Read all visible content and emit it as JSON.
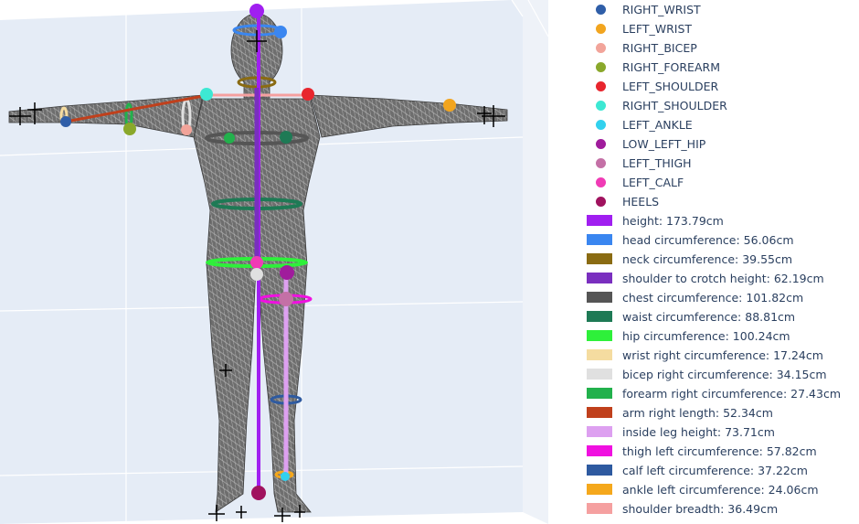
{
  "legend": {
    "markers": [
      {
        "label": "RIGHT_WRIST",
        "color": "#2f5ea8"
      },
      {
        "label": "LEFT_WRIST",
        "color": "#f2a51f"
      },
      {
        "label": "RIGHT_BICEP",
        "color": "#f2a49a"
      },
      {
        "label": "RIGHT_FOREARM",
        "color": "#8aa82b"
      },
      {
        "label": "LEFT_SHOULDER",
        "color": "#e8262e"
      },
      {
        "label": "RIGHT_SHOULDER",
        "color": "#3de8d3"
      },
      {
        "label": "LEFT_ANKLE",
        "color": "#32d1ee"
      },
      {
        "label": "LOW_LEFT_HIP",
        "color": "#a01c9c"
      },
      {
        "label": "LEFT_THIGH",
        "color": "#c470a6"
      },
      {
        "label": "LEFT_CALF",
        "color": "#f03bb5"
      },
      {
        "label": "HEELS",
        "color": "#a0125e"
      }
    ],
    "measurements": [
      {
        "label": "height: 173.79cm",
        "color": "#a01ff0"
      },
      {
        "label": "head circumference: 56.06cm",
        "color": "#3a86f0"
      },
      {
        "label": "neck circumference: 39.55cm",
        "color": "#8a6b12"
      },
      {
        "label": "shoulder to crotch height: 62.19cm",
        "color": "#7a2fbf"
      },
      {
        "label": "chest circumference: 101.82cm",
        "color": "#555555"
      },
      {
        "label": "waist circumference: 88.81cm",
        "color": "#1e7a55"
      },
      {
        "label": "hip circumference: 100.24cm",
        "color": "#2ef03a"
      },
      {
        "label": "wrist right circumference: 17.24cm",
        "color": "#f5dca0"
      },
      {
        "label": "bicep right circumference: 34.15cm",
        "color": "#e0e0e0"
      },
      {
        "label": "forearm right circumference: 27.43cm",
        "color": "#22b14c"
      },
      {
        "label": "arm right length: 52.34cm",
        "color": "#c0401c"
      },
      {
        "label": "inside leg height: 73.71cm",
        "color": "#dda0f0"
      },
      {
        "label": "thigh left circumference: 57.82cm",
        "color": "#f010e0"
      },
      {
        "label": "calf left circumference: 37.22cm",
        "color": "#2e5aa0"
      },
      {
        "label": "ankle left circumference: 24.06cm",
        "color": "#f5a81c"
      },
      {
        "label": "shoulder breadth: 36.49cm",
        "color": "#f5a0a0"
      }
    ]
  },
  "scene": {
    "background": "#e5ecf6",
    "mesh_color": "#6b6b6b"
  }
}
